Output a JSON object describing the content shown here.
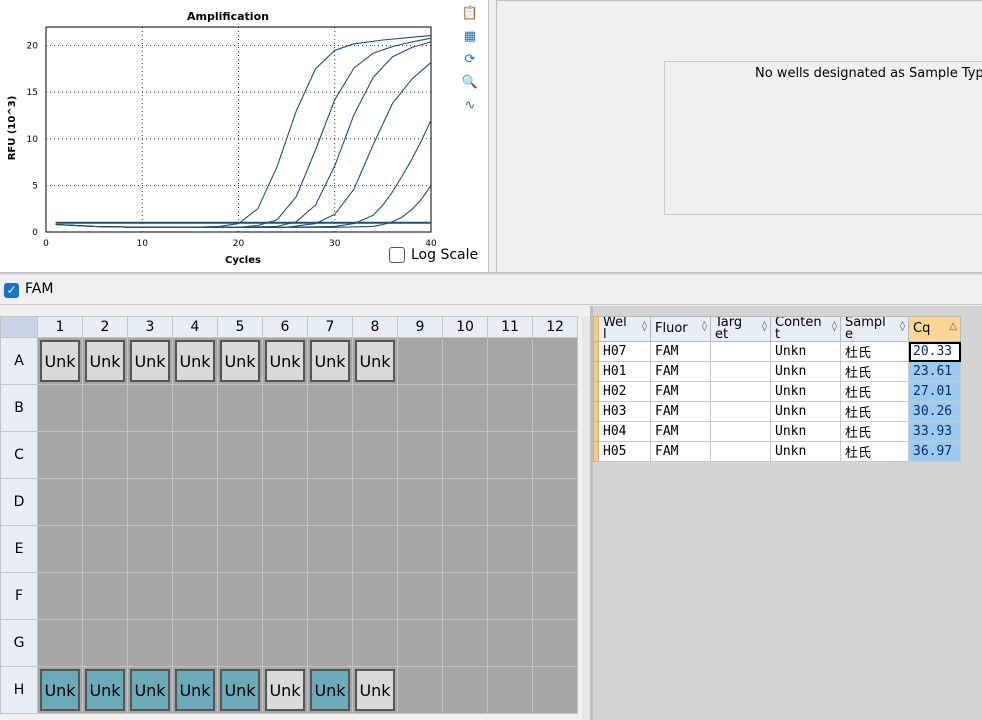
{
  "chart": {
    "title": "Amplification",
    "xlabel": "Cycles",
    "ylabel": "RFU (10^3)",
    "xticks": [
      "0",
      "10",
      "20",
      "30",
      "40"
    ],
    "yticks": [
      "0",
      "5",
      "10",
      "15",
      "20"
    ],
    "line_color": "#1f4e79",
    "log_scale_label": "Log Scale"
  },
  "chart_data": {
    "type": "line",
    "title": "Amplification",
    "xlabel": "Cycles",
    "ylabel": "RFU (10^3)",
    "xlim": [
      0,
      40
    ],
    "ylim": [
      0,
      22
    ],
    "grid": true,
    "series": [
      {
        "cq": 20.33,
        "plateau": 21.0,
        "x": [
          1,
          5,
          10,
          15,
          18,
          20,
          22,
          24,
          26,
          28,
          30,
          32,
          35,
          38,
          40
        ],
        "y": [
          0.8,
          0.6,
          0.5,
          0.5,
          0.6,
          0.9,
          2.5,
          7.0,
          13.0,
          17.5,
          19.5,
          20.2,
          20.6,
          20.9,
          21.1
        ]
      },
      {
        "cq": 23.61,
        "plateau": 20.8,
        "x": [
          1,
          5,
          10,
          15,
          20,
          22,
          24,
          26,
          28,
          30,
          32,
          34,
          36,
          38,
          40
        ],
        "y": [
          0.8,
          0.6,
          0.5,
          0.5,
          0.5,
          0.7,
          1.3,
          3.8,
          8.8,
          14.2,
          17.6,
          19.2,
          19.9,
          20.4,
          20.8
        ]
      },
      {
        "cq": 27.01,
        "plateau": 20.5,
        "x": [
          1,
          5,
          10,
          15,
          20,
          24,
          26,
          28,
          30,
          32,
          34,
          36,
          38,
          40
        ],
        "y": [
          0.8,
          0.6,
          0.5,
          0.5,
          0.5,
          0.6,
          1.1,
          2.9,
          7.1,
          12.6,
          16.6,
          18.8,
          19.8,
          20.4
        ]
      },
      {
        "cq": 30.26,
        "plateau": 19.8,
        "x": [
          1,
          5,
          10,
          15,
          20,
          25,
          28,
          30,
          32,
          34,
          36,
          38,
          40
        ],
        "y": [
          0.8,
          0.6,
          0.5,
          0.5,
          0.5,
          0.5,
          0.9,
          1.9,
          4.6,
          9.4,
          13.8,
          16.4,
          18.2
        ]
      },
      {
        "cq": 33.93,
        "plateau": 17.0,
        "x": [
          1,
          5,
          10,
          15,
          20,
          25,
          30,
          32,
          34,
          35,
          36,
          37,
          38,
          39,
          40
        ],
        "y": [
          0.8,
          0.6,
          0.5,
          0.5,
          0.5,
          0.5,
          0.6,
          0.9,
          1.8,
          2.9,
          4.3,
          6.0,
          7.8,
          9.8,
          12.0
        ]
      },
      {
        "cq": 36.97,
        "plateau": 10.0,
        "x": [
          1,
          5,
          10,
          15,
          20,
          25,
          30,
          34,
          35,
          36,
          37,
          38,
          39,
          40
        ],
        "y": [
          0.8,
          0.6,
          0.5,
          0.5,
          0.5,
          0.5,
          0.5,
          0.6,
          0.8,
          1.1,
          1.6,
          2.4,
          3.5,
          5.0
        ]
      },
      {
        "cq": null,
        "x": [
          1,
          5,
          10,
          15,
          20,
          25,
          30,
          35,
          40
        ],
        "y": [
          1.0,
          1.0,
          1.0,
          1.0,
          1.0,
          1.0,
          1.0,
          1.0,
          1.0
        ]
      }
    ]
  },
  "toolbar": {
    "icons": [
      "copy-icon",
      "export-icon",
      "refresh-icon",
      "zoom-icon",
      "chart-settings-icon"
    ],
    "glyphs": [
      "📋",
      "▦",
      "⟳",
      "🔍",
      "∿"
    ]
  },
  "message": {
    "no_wells": "No wells designated as Sample Type"
  },
  "fluor": {
    "checked": true,
    "label": "FAM"
  },
  "plate": {
    "columns": [
      "1",
      "2",
      "3",
      "4",
      "5",
      "6",
      "7",
      "8",
      "9",
      "10",
      "11",
      "12"
    ],
    "rows": [
      "A",
      "B",
      "C",
      "D",
      "E",
      "F",
      "G",
      "H"
    ],
    "row_A": [
      {
        "label": "Unk",
        "style": "gray"
      },
      {
        "label": "Unk",
        "style": "gray"
      },
      {
        "label": "Unk",
        "style": "gray"
      },
      {
        "label": "Unk",
        "style": "gray"
      },
      {
        "label": "Unk",
        "style": "gray"
      },
      {
        "label": "Unk",
        "style": "gray"
      },
      {
        "label": "Unk",
        "style": "gray"
      },
      {
        "label": "Unk",
        "style": "gray"
      }
    ],
    "row_H": [
      {
        "label": "Unk",
        "style": "teal"
      },
      {
        "label": "Unk",
        "style": "teal"
      },
      {
        "label": "Unk",
        "style": "teal"
      },
      {
        "label": "Unk",
        "style": "teal"
      },
      {
        "label": "Unk",
        "style": "teal"
      },
      {
        "label": "Unk",
        "style": "gray"
      },
      {
        "label": "Unk",
        "style": "teal"
      },
      {
        "label": "Unk",
        "style": "gray"
      }
    ]
  },
  "results": {
    "headers": [
      "Wel\nl",
      "Fluor",
      "Targ\net",
      "Conten\nt",
      "Sampl\ne",
      "Cq"
    ],
    "sort_glyph": "◊",
    "cq_sort_glyph": "△",
    "rows": [
      {
        "well": "H07",
        "fluor": "FAM",
        "target": "",
        "content": "Unkn",
        "sample": "杜氏",
        "cq": "20.33"
      },
      {
        "well": "H01",
        "fluor": "FAM",
        "target": "",
        "content": "Unkn",
        "sample": "杜氏",
        "cq": "23.61"
      },
      {
        "well": "H02",
        "fluor": "FAM",
        "target": "",
        "content": "Unkn",
        "sample": "杜氏",
        "cq": "27.01"
      },
      {
        "well": "H03",
        "fluor": "FAM",
        "target": "",
        "content": "Unkn",
        "sample": "杜氏",
        "cq": "30.26"
      },
      {
        "well": "H04",
        "fluor": "FAM",
        "target": "",
        "content": "Unkn",
        "sample": "杜氏",
        "cq": "33.93"
      },
      {
        "well": "H05",
        "fluor": "FAM",
        "target": "",
        "content": "Unkn",
        "sample": "杜氏",
        "cq": "36.97"
      }
    ]
  }
}
